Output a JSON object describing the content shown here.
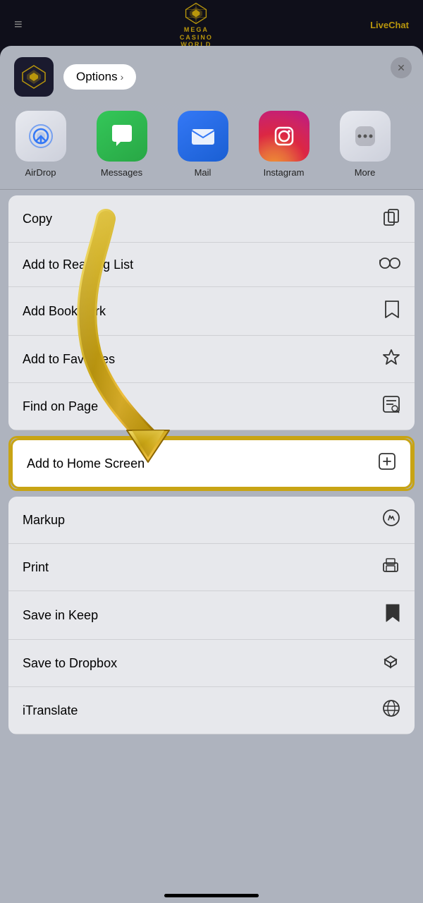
{
  "background": {
    "header": {
      "hamburger": "≡",
      "logo_line1": "MEGA",
      "logo_line2": "CASINO",
      "logo_line3": "WORLD",
      "chat_label": "LiveChat"
    }
  },
  "share_sheet": {
    "close_label": "×",
    "options_label": "Options",
    "options_chevron": "›",
    "apps": [
      {
        "id": "airdrop",
        "label": "AirDrop"
      },
      {
        "id": "messages",
        "label": "Messages"
      },
      {
        "id": "mail",
        "label": "Mail"
      },
      {
        "id": "instagram",
        "label": "Instagram"
      }
    ],
    "actions": [
      {
        "id": "copy",
        "label": "Copy",
        "icon": "copy"
      },
      {
        "id": "reading-list",
        "label": "Add to Reading List",
        "icon": "glasses"
      },
      {
        "id": "bookmark",
        "label": "Add Bookmark",
        "icon": "bookmark-open"
      },
      {
        "id": "favorites",
        "label": "Add to Favorites",
        "icon": "star"
      },
      {
        "id": "find-on-page",
        "label": "Find on Page",
        "icon": "find"
      },
      {
        "id": "add-home-screen",
        "label": "Add to Home Screen",
        "icon": "plus-square",
        "highlighted": true
      },
      {
        "id": "markup",
        "label": "Markup",
        "icon": "markup"
      },
      {
        "id": "print",
        "label": "Print",
        "icon": "print"
      },
      {
        "id": "save-keep",
        "label": "Save in Keep",
        "icon": "bookmark-fill"
      },
      {
        "id": "save-dropbox",
        "label": "Save to Dropbox",
        "icon": "dropbox"
      },
      {
        "id": "itranslate",
        "label": "iTranslate",
        "icon": "globe"
      }
    ]
  }
}
